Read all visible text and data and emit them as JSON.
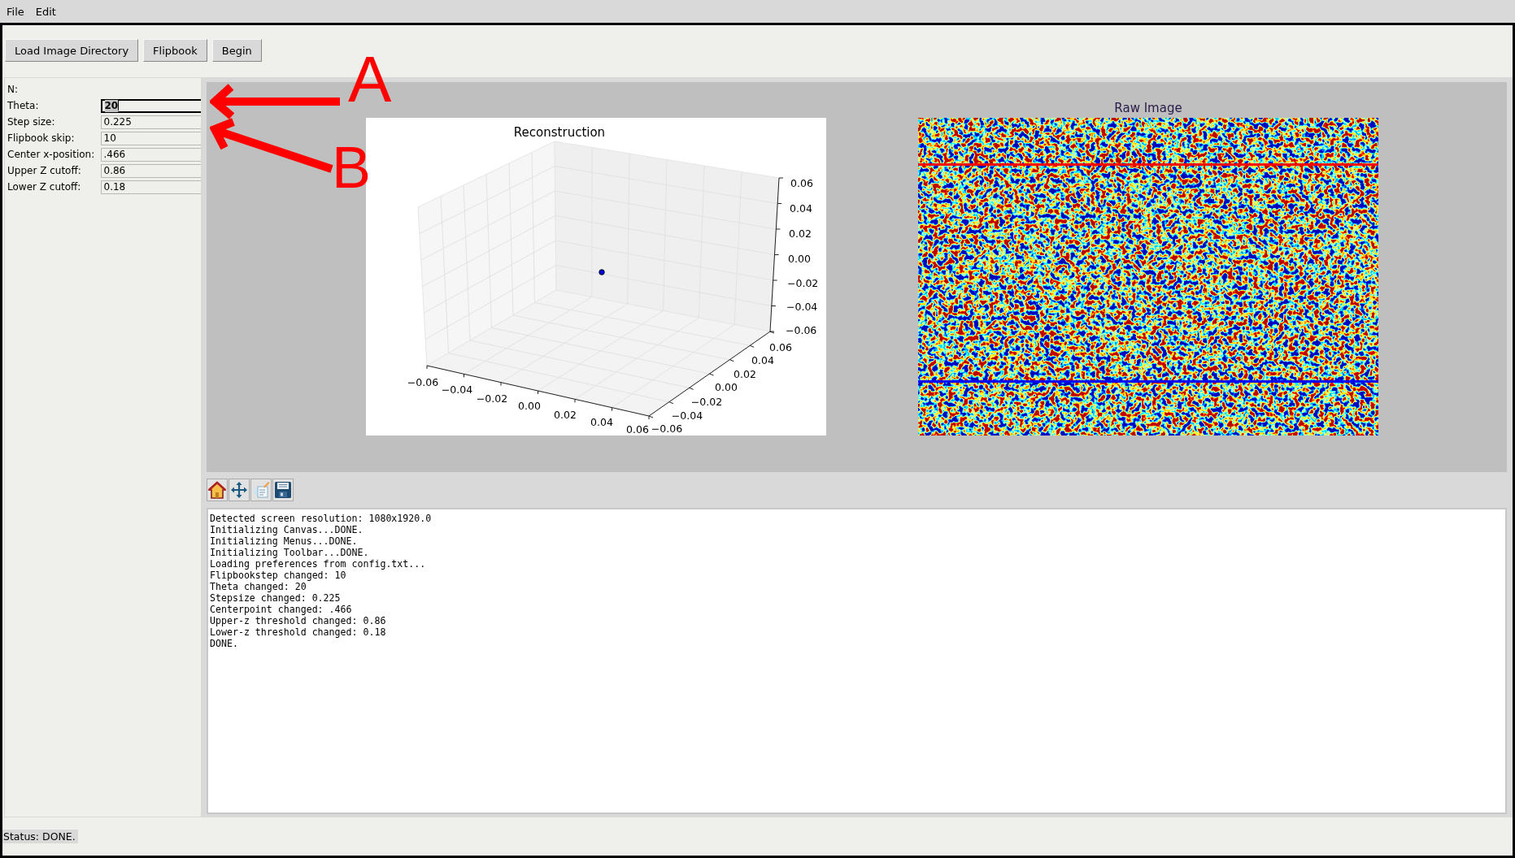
{
  "menu": [
    {
      "label": "File"
    },
    {
      "label": "Edit"
    }
  ],
  "toolbar_buttons": [
    "Load Image Directory",
    "Flipbook",
    "Begin"
  ],
  "parameters": [
    {
      "kind": "heading",
      "label": "N:"
    },
    {
      "kind": "entry",
      "label": "Theta:",
      "value": "20",
      "focused": true
    },
    {
      "kind": "entry",
      "label": "Step size:",
      "value": "0.225",
      "focused": false
    },
    {
      "kind": "entry",
      "label": "Flipbook skip:",
      "value": "10",
      "focused": false
    },
    {
      "kind": "entry",
      "label": "Center x-position:",
      "value": ".466",
      "focused": false
    },
    {
      "kind": "entry",
      "label": "Upper Z cutoff:",
      "value": "0.86",
      "focused": false
    },
    {
      "kind": "entry",
      "label": "Lower Z cutoff:",
      "value": "0.18",
      "focused": false
    }
  ],
  "reconstruction_plot": {
    "title": "Reconstruction",
    "x_tick_labels": [
      "−0.06",
      "−0.04",
      "−0.02",
      "0.00",
      "0.02",
      "0.04",
      "0.06"
    ],
    "y_tick_labels": [
      "0.06",
      "0.04",
      "0.02",
      "0.00",
      "−0.02",
      "−0.04",
      "−0.06"
    ],
    "z_tick_labels": [
      "0.06",
      "0.04",
      "0.02",
      "0.00",
      "−0.02",
      "−0.04",
      "−0.06"
    ]
  },
  "raw_image": {
    "title": "Raw Image"
  },
  "log_lines": [
    "Detected screen resolution: 1080x1920.0",
    "Initializing Canvas...DONE.",
    "Initializing Menus...DONE.",
    "Initializing Toolbar...DONE.",
    "Loading preferences from config.txt...",
    "Flipbookstep changed: 10",
    "Theta changed: 20",
    "Stepsize changed: 0.225",
    "Centerpoint changed: .466",
    "Upper-z threshold changed: 0.86",
    "Lower-z threshold changed: 0.18",
    "DONE."
  ],
  "status": "Status: DONE.",
  "annotations": [
    {
      "label": "A"
    },
    {
      "label": "B"
    }
  ]
}
